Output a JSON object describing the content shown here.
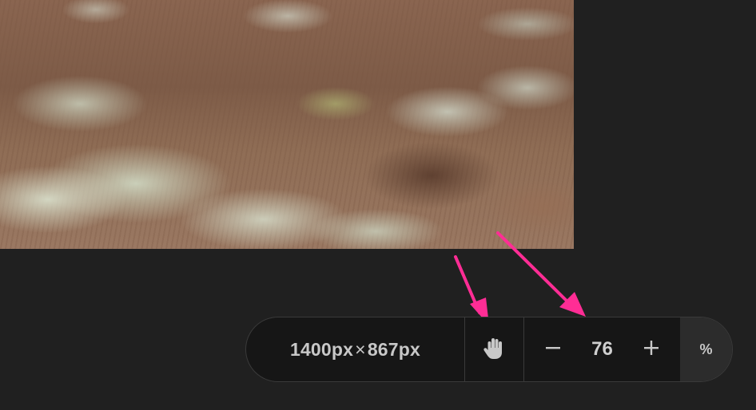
{
  "image": {
    "width_label": "1400px",
    "times_symbol": "×",
    "height_label": "867px"
  },
  "toolbar": {
    "pan_tool_icon": "hand-icon",
    "zoom_out_icon": "minus-icon",
    "zoom_in_icon": "plus-icon",
    "zoom_value": "76",
    "zoom_unit_label": "%"
  },
  "annotations": {
    "arrow_color": "#ff2d95"
  },
  "colors": {
    "background": "#202020",
    "toolbar_bg": "#161616",
    "toolbar_border": "#3a3a3a",
    "percent_bg": "#2c2c2c",
    "text": "#c8c8c8"
  }
}
